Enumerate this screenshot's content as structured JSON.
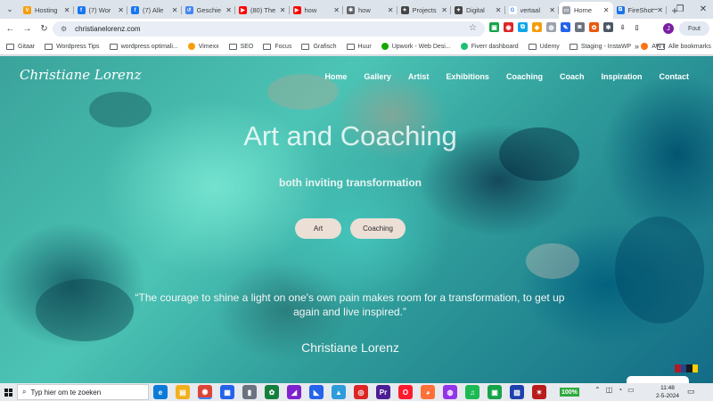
{
  "browser": {
    "tabs": [
      {
        "title": "Hosting",
        "icon": "v-icon",
        "color": "#f59e0b",
        "glyph": "V"
      },
      {
        "title": "(7) Wor",
        "icon": "facebook-icon",
        "color": "#1877f2",
        "glyph": "f"
      },
      {
        "title": "(7) Alle",
        "icon": "facebook-icon",
        "color": "#1877f2",
        "glyph": "f"
      },
      {
        "title": "Geschie",
        "icon": "history-icon",
        "color": "#4285f4",
        "glyph": "↺"
      },
      {
        "title": "(80) The",
        "icon": "youtube-icon",
        "color": "#ff0000",
        "glyph": "▶"
      },
      {
        "title": "how",
        "icon": "youtube-icon",
        "color": "#ff0000",
        "glyph": "▶"
      },
      {
        "title": "how",
        "icon": "puzzle-icon",
        "color": "#5f6368",
        "glyph": "✱"
      },
      {
        "title": "Projects",
        "icon": "star-icon",
        "color": "#444444",
        "glyph": "✦"
      },
      {
        "title": "Digital",
        "icon": "star-icon",
        "color": "#444444",
        "glyph": "✦"
      },
      {
        "title": "vertaal",
        "icon": "google-icon",
        "color": "#ffffff",
        "glyph": "G"
      },
      {
        "title": "Home",
        "icon": "page-icon",
        "color": "#9aa0a6",
        "glyph": "▭",
        "active": true
      },
      {
        "title": "FireShot",
        "icon": "fireshot-icon",
        "color": "#1a73e8",
        "glyph": "⧉"
      }
    ],
    "url": "christianelorenz.com",
    "profile_initial": "J",
    "error_label": "Fout",
    "bookmarks": [
      {
        "label": "Gitaar",
        "type": "folder"
      },
      {
        "label": "Wordpress Tips",
        "type": "folder"
      },
      {
        "label": "wordpress optimali...",
        "type": "folder"
      },
      {
        "label": "Vimexx",
        "type": "site",
        "color": "#f59e0b"
      },
      {
        "label": "SEO",
        "type": "folder"
      },
      {
        "label": "Focus",
        "type": "folder"
      },
      {
        "label": "Grafisch",
        "type": "folder"
      },
      {
        "label": "Huur",
        "type": "folder"
      },
      {
        "label": "Upwork - Web Desi...",
        "type": "site",
        "color": "#14a800"
      },
      {
        "label": "Fiverr dashboard",
        "type": "site",
        "color": "#1dbf73"
      },
      {
        "label": "Udemy",
        "type": "folder"
      },
      {
        "label": "Staging - InstaWP",
        "type": "folder"
      },
      {
        "label": "AWT",
        "type": "site",
        "color": "#f97316"
      },
      {
        "label": "Alle bookmarks",
        "type": "folder"
      }
    ]
  },
  "site": {
    "logo": "Christiane Lorenz",
    "nav": [
      "Home",
      "Gallery",
      "Artist",
      "Exhibitions",
      "Coaching",
      "Coach",
      "Inspiration",
      "Contact"
    ],
    "hero_title": "Art and Coaching",
    "hero_subtitle": "both inviting transformation",
    "buttons": {
      "art": "Art",
      "coaching": "Coaching"
    },
    "quote": "“The courage to shine a light on one's own pain makes room for a transformation, to get up again and live inspired.”",
    "author": "Christiane Lorenz"
  },
  "taskbar": {
    "search_placeholder": "Typ hier om te zoeken",
    "apps": [
      {
        "icon": "edge-icon",
        "color": "#0c7bd8",
        "glyph": "e"
      },
      {
        "icon": "file-explorer-icon",
        "color": "#f2b01e",
        "glyph": "▤"
      },
      {
        "icon": "chrome-icon",
        "color": "#db4437",
        "glyph": "◉",
        "running": true
      },
      {
        "icon": "store-icon",
        "color": "#2563eb",
        "glyph": "▦"
      },
      {
        "icon": "usb-icon",
        "color": "#6b7280",
        "glyph": "▮"
      },
      {
        "icon": "app-icon",
        "color": "#15803d",
        "glyph": "✿"
      },
      {
        "icon": "affinity-icon",
        "color": "#7e22ce",
        "glyph": "◢"
      },
      {
        "icon": "designer-icon",
        "color": "#2563eb",
        "glyph": "◣"
      },
      {
        "icon": "photo-icon",
        "color": "#2d9cdb",
        "glyph": "▲"
      },
      {
        "icon": "screen-icon",
        "color": "#dc2626",
        "glyph": "◎"
      },
      {
        "icon": "premiere-icon",
        "color": "#4c1d95",
        "glyph": "Pr"
      },
      {
        "icon": "opera-icon",
        "color": "#ff1b2d",
        "glyph": "O"
      },
      {
        "icon": "firefox-icon",
        "color": "#ff7139",
        "glyph": "◕"
      },
      {
        "icon": "app-purple-icon",
        "color": "#9333ea",
        "glyph": "◍"
      },
      {
        "icon": "spotify-icon",
        "color": "#1db954",
        "glyph": "♫"
      },
      {
        "icon": "app-green-icon",
        "color": "#16a34a",
        "glyph": "▣"
      },
      {
        "icon": "save-icon",
        "color": "#1e40af",
        "glyph": "▨"
      },
      {
        "icon": "app-red-icon",
        "color": "#b91c1c",
        "glyph": "✶"
      }
    ],
    "battery": "100%",
    "time": "11:48",
    "date": "2-5-2024"
  }
}
